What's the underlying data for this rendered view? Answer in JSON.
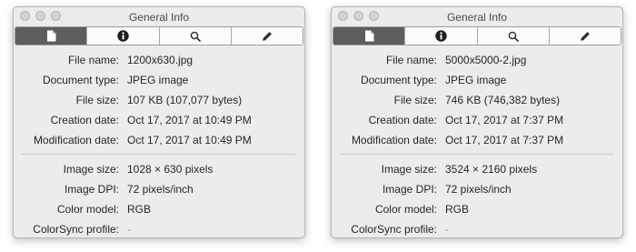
{
  "windows": [
    {
      "title": "General Info",
      "tabs": [
        {
          "icon": "document-icon",
          "selected": true
        },
        {
          "icon": "info-icon",
          "selected": false
        },
        {
          "icon": "search-icon",
          "selected": false
        },
        {
          "icon": "pencil-icon",
          "selected": false
        }
      ],
      "file_rows": [
        {
          "label": "File name:",
          "value": "1200x630.jpg"
        },
        {
          "label": "Document type:",
          "value": "JPEG image"
        },
        {
          "label": "File size:",
          "value": "107 KB (107,077 bytes)"
        },
        {
          "label": "Creation date:",
          "value": "Oct 17, 2017 at 10:49 PM"
        },
        {
          "label": "Modification date:",
          "value": "Oct 17, 2017 at 10:49 PM"
        }
      ],
      "image_rows": [
        {
          "label": "Image size:",
          "value": "1028 × 630 pixels"
        },
        {
          "label": "Image DPI:",
          "value": "72 pixels/inch"
        },
        {
          "label": "Color model:",
          "value": "RGB"
        },
        {
          "label": "ColorSync profile:",
          "value": "-"
        }
      ]
    },
    {
      "title": "General Info",
      "tabs": [
        {
          "icon": "document-icon",
          "selected": true
        },
        {
          "icon": "info-icon",
          "selected": false
        },
        {
          "icon": "search-icon",
          "selected": false
        },
        {
          "icon": "pencil-icon",
          "selected": false
        }
      ],
      "file_rows": [
        {
          "label": "File name:",
          "value": "5000x5000-2.jpg"
        },
        {
          "label": "Document type:",
          "value": "JPEG image"
        },
        {
          "label": "File size:",
          "value": "746 KB (746,382 bytes)"
        },
        {
          "label": "Creation date:",
          "value": "Oct 17, 2017 at 7:37 PM"
        },
        {
          "label": "Modification date:",
          "value": "Oct 17, 2017 at 7:37 PM"
        }
      ],
      "image_rows": [
        {
          "label": "Image size:",
          "value": "3524 × 2160 pixels"
        },
        {
          "label": "Image DPI:",
          "value": "72 pixels/inch"
        },
        {
          "label": "Color model:",
          "value": "RGB"
        },
        {
          "label": "ColorSync profile:",
          "value": "-"
        }
      ]
    }
  ],
  "colors": {
    "selected_tab": "#5e5e5e",
    "window_bg": "#ececec",
    "text": "#262626"
  }
}
